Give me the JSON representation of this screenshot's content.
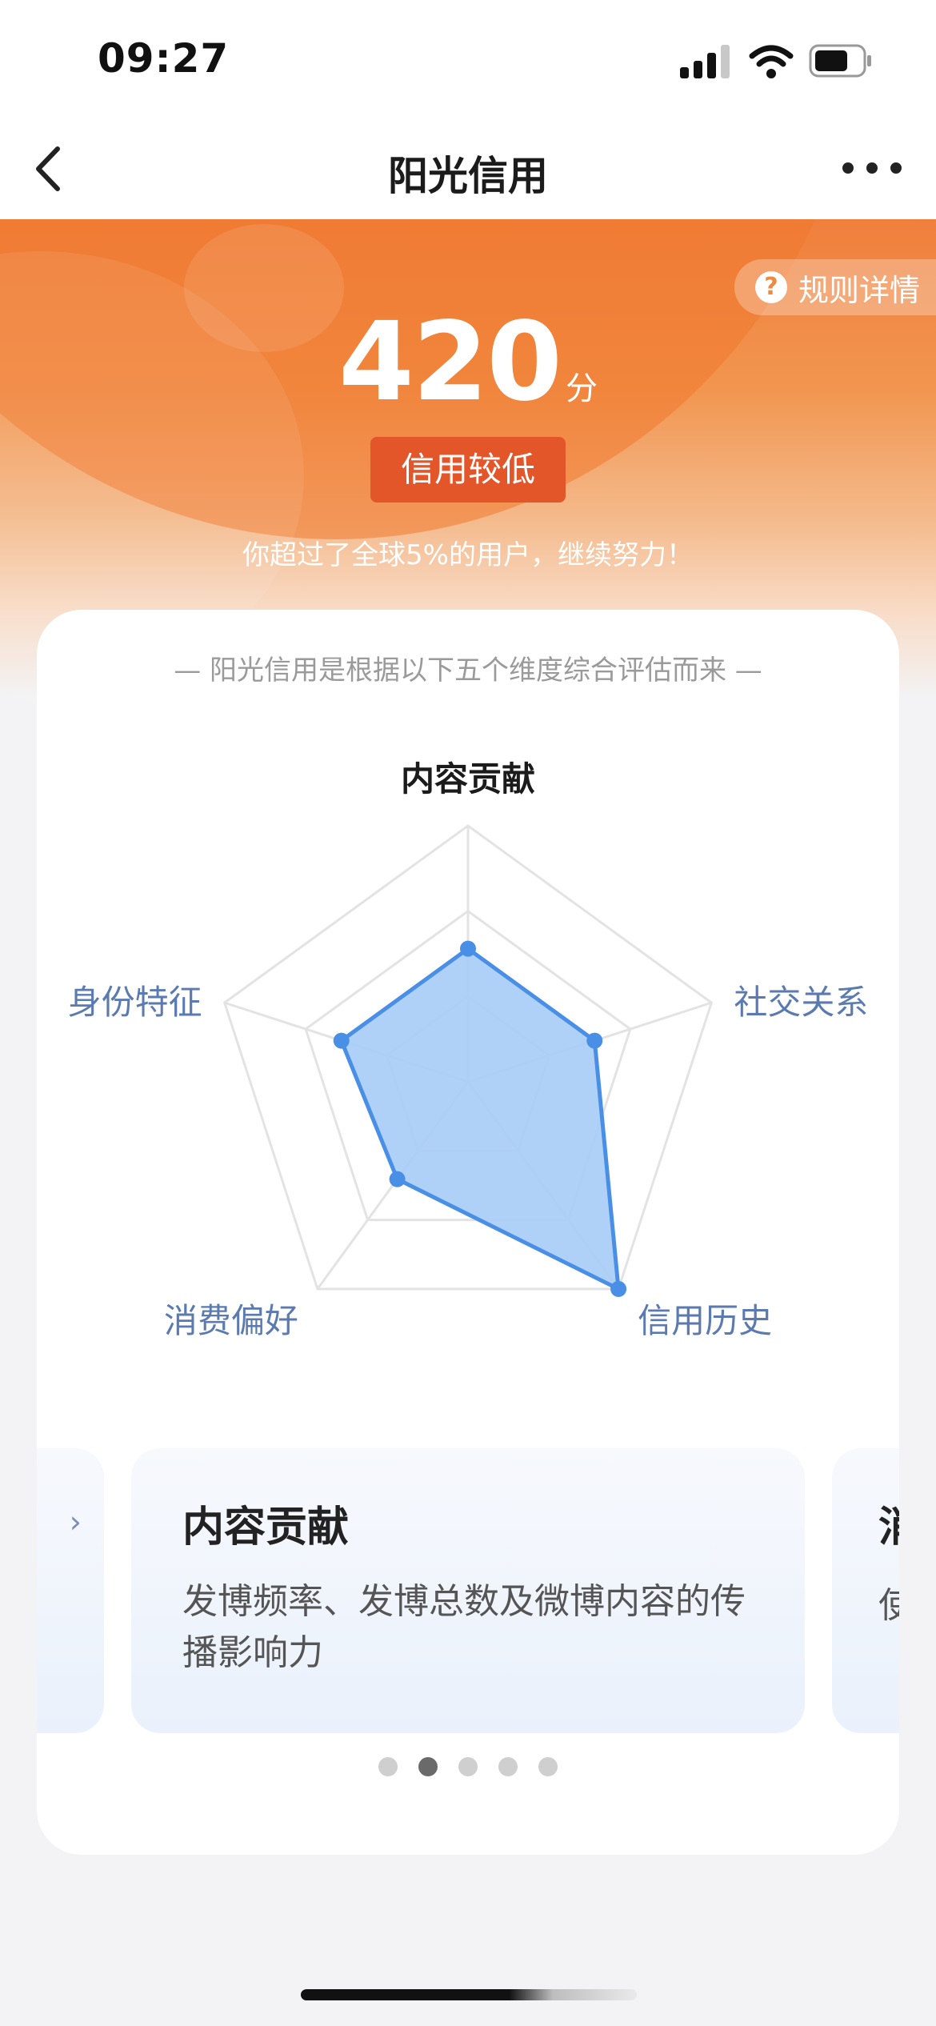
{
  "status_bar": {
    "time": "09:27"
  },
  "nav": {
    "title": "阳光信用",
    "back_icon": "chevron-left-icon",
    "more_icon": "more-horizontal-icon"
  },
  "hero": {
    "rules_label": "规则详情",
    "rules_icon_glyph": "?",
    "score": "420",
    "score_unit": "分",
    "level": "信用较低",
    "description": "你超过了全球5%的用户，继续努力！",
    "colors": {
      "hero_orange": "#f07f3c",
      "badge_red": "#e2562a"
    }
  },
  "card": {
    "subtitle": "— 阳光信用是根据以下五个维度综合评估而来 —"
  },
  "chart_data": {
    "type": "radar",
    "axes": [
      "内容贡献",
      "社交关系",
      "信用历史",
      "消费偏好",
      "身份特征"
    ],
    "active_axis": "内容贡献",
    "values": [
      0.52,
      0.52,
      1.0,
      0.47,
      0.52
    ],
    "scale_max": 1.0,
    "grid_levels": 3,
    "fill_color": "#a9cdf6",
    "line_color": "#4a8fe6"
  },
  "carousel": {
    "prev_chevron": "›",
    "current": {
      "title": "内容贡献",
      "description": "发博频率、发博总数及微博内容的传播影响力"
    },
    "next_peek": {
      "title": "消",
      "description": "使"
    },
    "page_count": 5,
    "active_index": 1
  }
}
